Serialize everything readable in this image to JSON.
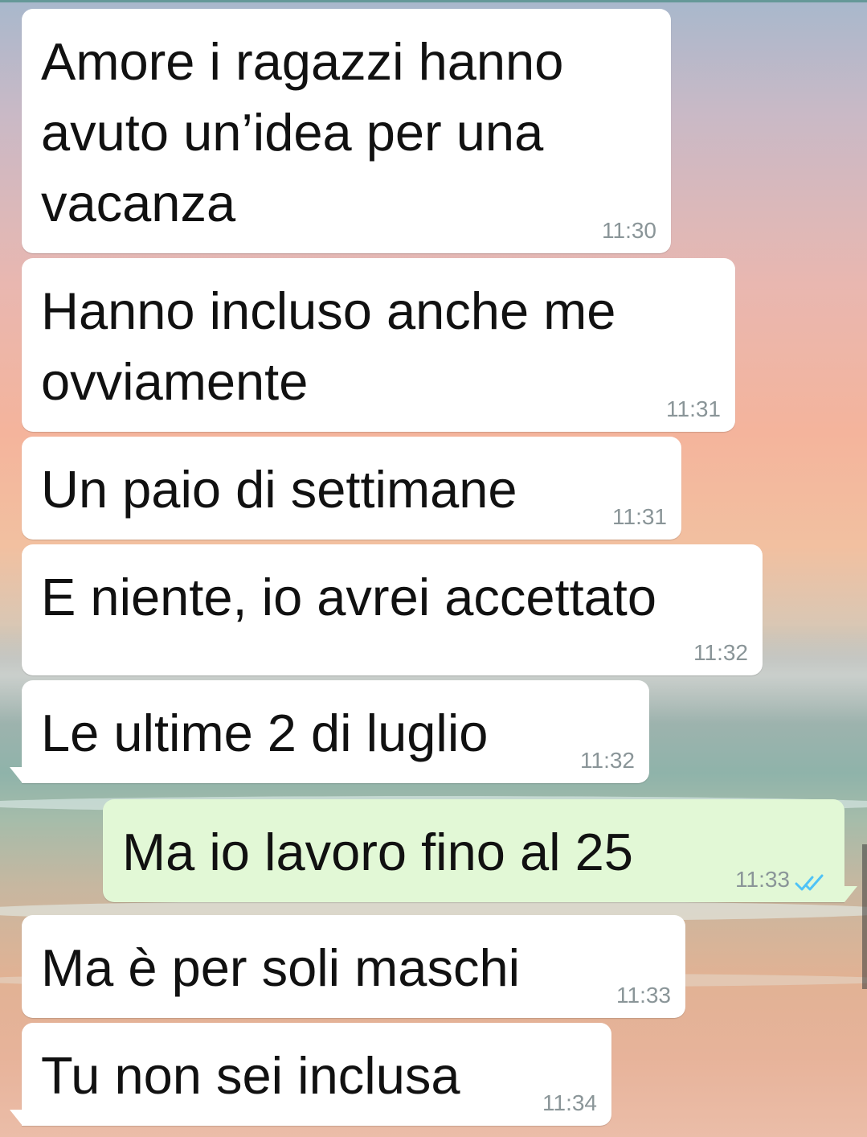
{
  "chat": {
    "messages": [
      {
        "text": "Amore i ragazzi hanno avuto un’idea per una vacanza",
        "time": "11:30",
        "direction": "incoming"
      },
      {
        "text": "Hanno incluso anche me ovviamente",
        "time": "11:31",
        "direction": "incoming"
      },
      {
        "text": "Un paio di settimane",
        "time": "11:31",
        "direction": "incoming"
      },
      {
        "text": "E niente, io avrei accettato",
        "time": "11:32",
        "direction": "incoming"
      },
      {
        "text": "Le ultime 2 di luglio",
        "time": "11:32",
        "direction": "incoming"
      },
      {
        "text": "Ma io lavoro fino al 25",
        "time": "11:33",
        "direction": "outgoing",
        "status": "read"
      },
      {
        "text": "Ma è per soli maschi",
        "time": "11:33",
        "direction": "incoming"
      },
      {
        "text": "Tu non sei inclusa",
        "time": "11:34",
        "direction": "incoming"
      }
    ]
  },
  "colors": {
    "incoming_bubble": "#ffffff",
    "outgoing_bubble": "#e2f8d6",
    "timestamp": "#8a9598",
    "read_ticks": "#4fc3f7"
  },
  "icons": {
    "read_receipt": "double-check-icon"
  }
}
